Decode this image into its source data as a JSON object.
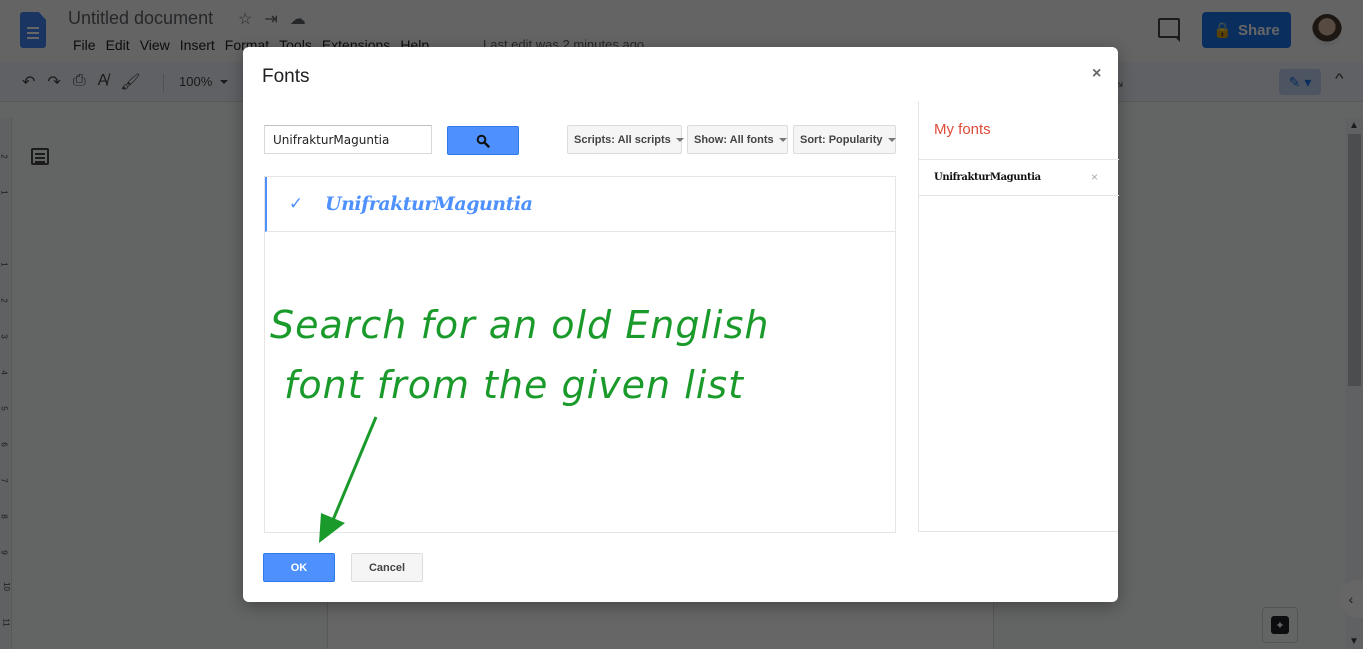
{
  "app": {
    "doc_title": "Untitled document",
    "title_icons": [
      "star-icon",
      "move-to-folder-icon",
      "cloud-saved-icon"
    ],
    "menu": [
      "File",
      "Edit",
      "View",
      "Insert",
      "Format",
      "Tools",
      "Extensions",
      "Help"
    ],
    "last_edit": "Last edit was 2 minutes ago",
    "share_label": "Share",
    "zoom_level": "100%",
    "ruler_numbers": [
      "2",
      "1",
      "1",
      "2",
      "3",
      "4",
      "5",
      "6",
      "7",
      "8",
      "9",
      "10",
      "11"
    ]
  },
  "dialog": {
    "title": "Fonts",
    "close_glyph": "×",
    "search": {
      "value": "UnifrakturMaguntia",
      "placeholder": ""
    },
    "filters": {
      "scripts": "Scripts: All scripts",
      "show": "Show: All fonts",
      "sort": "Sort: Popularity"
    },
    "font_results": [
      {
        "name": "UnifrakturMaguntia",
        "selected": true,
        "check_glyph": "✓"
      }
    ],
    "my_fonts": {
      "title": "My fonts",
      "items": [
        {
          "name": "UnifrakturMaguntia",
          "remove_glyph": "×"
        }
      ]
    },
    "ok_label": "OK",
    "cancel_label": "Cancel"
  },
  "annotation": {
    "line1": "Search for an old English",
    "line2": "font from the given list",
    "color": "#1a9a2a"
  },
  "colors": {
    "accent_blue": "#4d90fe",
    "my_fonts_red": "#dd4b39",
    "share_blue": "#1a73e8"
  }
}
